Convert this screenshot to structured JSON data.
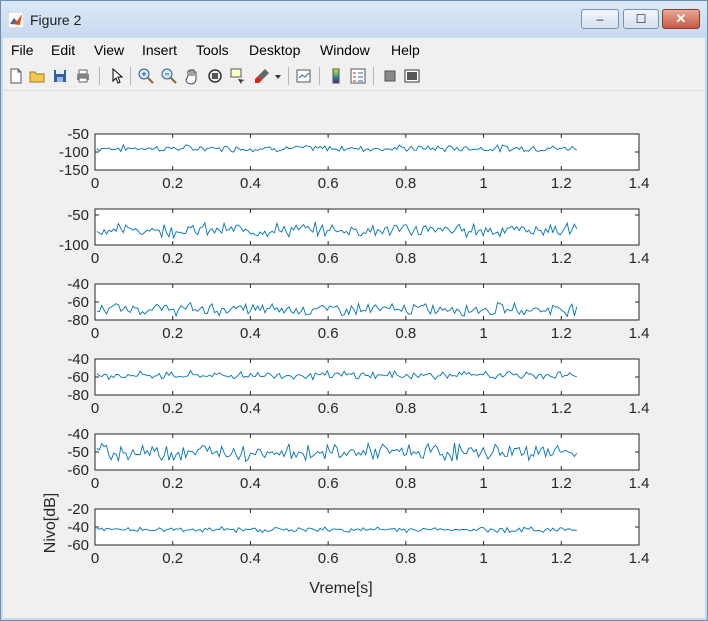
{
  "window": {
    "title": "Figure 2",
    "minimize": "–",
    "maximize": "☐",
    "close": "✕",
    "dock": "↘"
  },
  "menu": [
    "File",
    "Edit",
    "View",
    "Insert",
    "Tools",
    "Desktop",
    "Window",
    "Help"
  ],
  "toolbar_icons": [
    "new-figure-icon",
    "open-file-icon",
    "save-icon",
    "print-icon",
    "arrow-pointer-icon",
    "zoom-in-icon",
    "zoom-out-icon",
    "pan-hand-icon",
    "rotate-3d-icon",
    "data-cursor-icon",
    "brush-icon",
    "brush-dropdown-icon",
    "link-plot-icon",
    "colorbar-icon",
    "legend-icon",
    "hide-plot-tools-icon",
    "show-plot-tools-icon"
  ],
  "colors": {
    "line": "#0072bd",
    "axes_bg": "#ffffff",
    "figure_bg": "#f0f0f0"
  },
  "chart_data": [
    {
      "type": "line",
      "xlim": [
        0,
        1.4
      ],
      "xticks": [
        "0",
        "0.2",
        "0.4",
        "0.6",
        "0.8",
        "1",
        "1.2",
        "1.4"
      ],
      "yticks": [
        "-50",
        "-100",
        "-150"
      ],
      "ylim": [
        -150,
        -50
      ],
      "series_mean": -90,
      "series_amp": 8,
      "x_end": 1.24
    },
    {
      "type": "line",
      "xlim": [
        0,
        1.4
      ],
      "xticks": [
        "0",
        "0.2",
        "0.4",
        "0.6",
        "0.8",
        "1",
        "1.2",
        "1.4"
      ],
      "yticks": [
        "-50",
        "-100"
      ],
      "ylim": [
        -100,
        -40
      ],
      "series_mean": -75,
      "series_amp": 10,
      "x_end": 1.24
    },
    {
      "type": "line",
      "xlim": [
        0,
        1.4
      ],
      "xticks": [
        "0",
        "0.2",
        "0.4",
        "0.6",
        "0.8",
        "1",
        "1.2",
        "1.4"
      ],
      "yticks": [
        "-40",
        "-60",
        "-80"
      ],
      "ylim": [
        -80,
        -40
      ],
      "series_mean": -68,
      "series_amp": 6,
      "x_end": 1.24
    },
    {
      "type": "line",
      "xlim": [
        0,
        1.4
      ],
      "xticks": [
        "0",
        "0.2",
        "0.4",
        "0.6",
        "0.8",
        "1",
        "1.2",
        "1.4"
      ],
      "yticks": [
        "-40",
        "-60",
        "-80"
      ],
      "ylim": [
        -80,
        -40
      ],
      "series_mean": -58,
      "series_amp": 4,
      "x_end": 1.24
    },
    {
      "type": "line",
      "xlim": [
        0,
        1.4
      ],
      "xticks": [
        "0",
        "0.2",
        "0.4",
        "0.6",
        "0.8",
        "1",
        "1.2",
        "1.4"
      ],
      "yticks": [
        "-40",
        "-50",
        "-60"
      ],
      "ylim": [
        -60,
        -40
      ],
      "series_mean": -50,
      "series_amp": 4,
      "x_end": 1.24
    },
    {
      "type": "line",
      "xlim": [
        0,
        1.4
      ],
      "xticks": [
        "0",
        "0.2",
        "0.4",
        "0.6",
        "0.8",
        "1",
        "1.2",
        "1.4"
      ],
      "yticks": [
        "-20",
        "-40",
        "-60"
      ],
      "ylim": [
        -60,
        -20
      ],
      "series_mean": -43,
      "series_amp": 2.5,
      "x_end": 1.24,
      "xlabel": "Vreme[s]",
      "ylabel": "Nivo[dB]"
    }
  ]
}
